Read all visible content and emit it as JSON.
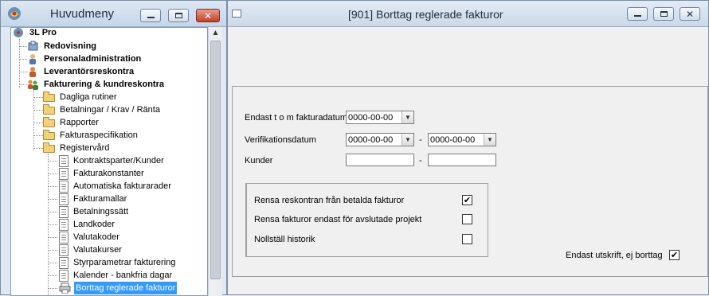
{
  "left_window": {
    "title": "Huvudmeny",
    "tree": {
      "root": "3L Pro",
      "level1": [
        "Redovisning",
        "Personaladministration",
        "Leverantörsreskontra",
        "Fakturering & kundreskontra"
      ],
      "folders": [
        "Dagliga rutiner",
        "Betalningar / Krav / Ränta",
        "Rapporter",
        "Fakturaspecifikation",
        "Registervård"
      ],
      "items": [
        "Kontraktsparter/Kunder",
        "Fakturakonstanter",
        "Automatiska fakturarader",
        "Fakturamallar",
        "Betalningssätt",
        "Landkoder",
        "Valutakoder",
        "Valutakurser",
        "Styrparametrar fakturering",
        "Kalender - bankfria dagar",
        "Borttag reglerade fakturor"
      ],
      "selected": "Borttag reglerade fakturor"
    }
  },
  "right_window": {
    "title": "[901]  Borttag reglerade fakturor",
    "form": {
      "date_label": "Endast t o m fakturadatum",
      "date_value": "0000-00-00",
      "verif_label": "Verifikationsdatum",
      "verif_from": "0000-00-00",
      "verif_to": "0000-00-00",
      "dash": "-",
      "kunder_label": "Kunder",
      "kunder_from": "",
      "kunder_to": ""
    },
    "options": [
      {
        "label": "Rensa reskontran från betalda fakturor",
        "checked": true
      },
      {
        "label": "Rensa fakturor endast för avslutade projekt",
        "checked": false
      },
      {
        "label": "Nollställ historik",
        "checked": false
      }
    ],
    "print_only": {
      "label": "Endast utskrift, ej borttag",
      "checked": true
    }
  },
  "colors": {
    "selection": "#3399ff",
    "close_button": "#c0402c",
    "folder": "#f1d17a"
  }
}
